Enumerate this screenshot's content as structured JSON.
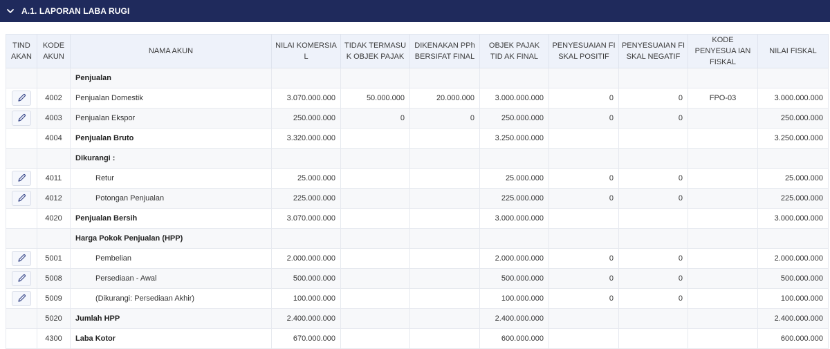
{
  "section": {
    "title": "A.1. LAPORAN LABA RUGI",
    "toggle_icon": "chevron-down-icon"
  },
  "columns": [
    {
      "label": "TIND AKAN"
    },
    {
      "label": "KODE AKUN"
    },
    {
      "label": "NAMA AKUN"
    },
    {
      "label": "NILAI KOMERSIA L"
    },
    {
      "label": "TIDAK TERMASU K OBJEK PAJAK"
    },
    {
      "label": "DIKENAKAN PPh BERSIFAT FINAL"
    },
    {
      "label": "OBJEK PAJAK TID AK FINAL"
    },
    {
      "label": "PENYESUAIAN FI SKAL POSITIF"
    },
    {
      "label": "PENYESUAIAN FI SKAL NEGATIF"
    },
    {
      "label": "KODE PENYESUA IAN FISKAL"
    },
    {
      "label": "NILAI FISKAL"
    }
  ],
  "rows": [
    {
      "edit": false,
      "code": "",
      "name": "Penjualan",
      "style": "bold",
      "komersial": "",
      "tidak": "",
      "final": "",
      "objek": "",
      "pos": "",
      "neg": "",
      "kode_fiskal": "",
      "fiskal": ""
    },
    {
      "edit": true,
      "code": "4002",
      "name": "Penjualan Domestik",
      "style": "normal",
      "komersial": "3.070.000.000",
      "tidak": "50.000.000",
      "final": "20.000.000",
      "objek": "3.000.000.000",
      "pos": "0",
      "neg": "0",
      "kode_fiskal": "FPO-03",
      "fiskal": "3.000.000.000"
    },
    {
      "edit": true,
      "code": "4003",
      "name": "Penjualan Ekspor",
      "style": "normal",
      "komersial": "250.000.000",
      "tidak": "0",
      "final": "0",
      "objek": "250.000.000",
      "pos": "0",
      "neg": "0",
      "kode_fiskal": "",
      "fiskal": "250.000.000"
    },
    {
      "edit": false,
      "code": "4004",
      "name": "Penjualan Bruto",
      "style": "bold",
      "komersial": "3.320.000.000",
      "tidak": "",
      "final": "",
      "objek": "3.250.000.000",
      "pos": "",
      "neg": "",
      "kode_fiskal": "",
      "fiskal": "3.250.000.000"
    },
    {
      "edit": false,
      "code": "",
      "name": "Dikurangi :",
      "style": "bold",
      "komersial": "",
      "tidak": "",
      "final": "",
      "objek": "",
      "pos": "",
      "neg": "",
      "kode_fiskal": "",
      "fiskal": ""
    },
    {
      "edit": true,
      "code": "4011",
      "name": "Retur",
      "style": "indent",
      "komersial": "25.000.000",
      "tidak": "",
      "final": "",
      "objek": "25.000.000",
      "pos": "0",
      "neg": "0",
      "kode_fiskal": "",
      "fiskal": "25.000.000"
    },
    {
      "edit": true,
      "code": "4012",
      "name": "Potongan Penjualan",
      "style": "indent",
      "komersial": "225.000.000",
      "tidak": "",
      "final": "",
      "objek": "225.000.000",
      "pos": "0",
      "neg": "0",
      "kode_fiskal": "",
      "fiskal": "225.000.000"
    },
    {
      "edit": false,
      "code": "4020",
      "name": "Penjualan Bersih",
      "style": "bold",
      "komersial": "3.070.000.000",
      "tidak": "",
      "final": "",
      "objek": "3.000.000.000",
      "pos": "",
      "neg": "",
      "kode_fiskal": "",
      "fiskal": "3.000.000.000"
    },
    {
      "edit": false,
      "code": "",
      "name": "Harga Pokok Penjualan (HPP)",
      "style": "bold",
      "komersial": "",
      "tidak": "",
      "final": "",
      "objek": "",
      "pos": "",
      "neg": "",
      "kode_fiskal": "",
      "fiskal": ""
    },
    {
      "edit": true,
      "code": "5001",
      "name": "Pembelian",
      "style": "indent",
      "komersial": "2.000.000.000",
      "tidak": "",
      "final": "",
      "objek": "2.000.000.000",
      "pos": "0",
      "neg": "0",
      "kode_fiskal": "",
      "fiskal": "2.000.000.000"
    },
    {
      "edit": true,
      "code": "5008",
      "name": "Persediaan - Awal",
      "style": "indent",
      "komersial": "500.000.000",
      "tidak": "",
      "final": "",
      "objek": "500.000.000",
      "pos": "0",
      "neg": "0",
      "kode_fiskal": "",
      "fiskal": "500.000.000"
    },
    {
      "edit": true,
      "code": "5009",
      "name": "(Dikurangi: Persediaan Akhir)",
      "style": "indent",
      "komersial": "100.000.000",
      "tidak": "",
      "final": "",
      "objek": "100.000.000",
      "pos": "0",
      "neg": "0",
      "kode_fiskal": "",
      "fiskal": "100.000.000"
    },
    {
      "edit": false,
      "code": "5020",
      "name": "Jumlah HPP",
      "style": "bold",
      "komersial": "2.400.000.000",
      "tidak": "",
      "final": "",
      "objek": "2.400.000.000",
      "pos": "",
      "neg": "",
      "kode_fiskal": "",
      "fiskal": "2.400.000.000"
    },
    {
      "edit": false,
      "code": "4300",
      "name": "Laba Kotor",
      "style": "bold",
      "komersial": "670.000.000",
      "tidak": "",
      "final": "",
      "objek": "600.000.000",
      "pos": "",
      "neg": "",
      "kode_fiskal": "",
      "fiskal": "600.000.000"
    }
  ],
  "colors": {
    "header_bg": "#1f2a5c",
    "table_header_bg": "#eef2fa",
    "icon_color": "#3b4a8c"
  },
  "icons": {
    "edit": "pencil-icon"
  }
}
